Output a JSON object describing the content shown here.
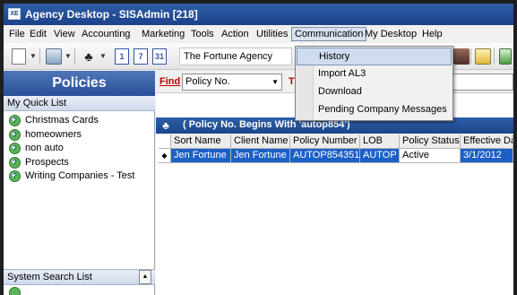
{
  "window": {
    "title": "Agency Desktop - SISAdmin [218]",
    "app_icon_text": "XE"
  },
  "menubar": {
    "items": [
      "File",
      "Edit",
      "View",
      "Accounting",
      "Marketing",
      "Tools",
      "Action",
      "Utilities",
      "Communication",
      "My Desktop",
      "Help"
    ],
    "open_menu": "Communication"
  },
  "toolbar": {
    "agency_select": "The Fortune Agency",
    "calendar_1": "1",
    "calendar_7": "7",
    "calendar_31": "31"
  },
  "left_panel": {
    "header": "Policies",
    "quick_list_title": "My Quick List",
    "quick_list": [
      {
        "label": "Christmas Cards",
        "icon": "question-icon"
      },
      {
        "label": "homeowners",
        "icon": "question-icon"
      },
      {
        "label": "non auto",
        "icon": "question-icon"
      },
      {
        "label": "Prospects",
        "icon": "question-icon"
      },
      {
        "label": "Writing Companies - Test",
        "icon": "question-icon"
      }
    ],
    "system_search_title": "System Search List"
  },
  "find_bar": {
    "label": "Find",
    "field": "Policy No.",
    "next_label": "T"
  },
  "results": {
    "title": "( Policy No. Begins With 'autop854')",
    "columns": [
      "Sort Name",
      "Client Name",
      "Policy Number",
      "LOB",
      "Policy Status",
      "Effective Da"
    ],
    "rows": [
      [
        "Jen Fortune",
        "Jen Fortune",
        "AUTOP854351",
        "AUTOP",
        "Active",
        "3/1/2012"
      ]
    ],
    "selected_marker": "◆"
  },
  "communication_menu": {
    "items": [
      "History",
      "Import AL3",
      "Download",
      "Pending Company Messages"
    ],
    "highlighted": "History"
  },
  "colors": {
    "title_bar": "#1b4189",
    "selection": "#1c5fc7",
    "find_label": "#c00000"
  }
}
